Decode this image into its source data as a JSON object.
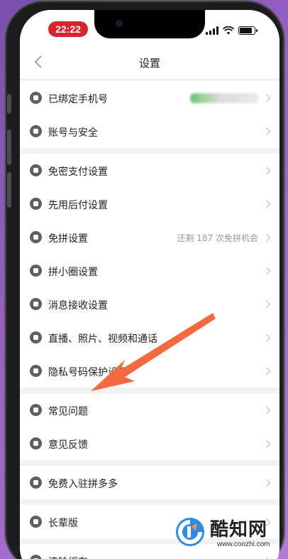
{
  "status_bar": {
    "time": "22:22",
    "time_pill_color": "#d9232d",
    "signal_bars": 4,
    "battery_level": 0.85,
    "icons": [
      "signal-icon",
      "wifi-icon",
      "battery-icon"
    ]
  },
  "nav": {
    "title": "设置",
    "back_icon": "chevron-left-icon"
  },
  "groups": [
    {
      "items": [
        {
          "label": "已绑定手机号",
          "icon": "phone-icon",
          "value": "",
          "value_obscured": true
        },
        {
          "label": "账号与安全",
          "icon": "shield-icon",
          "value": ""
        }
      ]
    },
    {
      "items": [
        {
          "label": "免密支付设置",
          "icon": "key-icon",
          "value": ""
        },
        {
          "label": "先用后付设置",
          "icon": "clock-icon",
          "value": ""
        },
        {
          "label": "免拼设置",
          "icon": "group-icon",
          "value": "还剩 187 次免拼机会"
        },
        {
          "label": "拼小圈设置",
          "icon": "circle-icon",
          "value": ""
        },
        {
          "label": "消息接收设置",
          "icon": "message-icon",
          "value": ""
        },
        {
          "label": "直播、照片、视频和通话",
          "icon": "video-icon",
          "value": ""
        },
        {
          "label": "隐私号码保护设置",
          "icon": "privacy-icon",
          "value": ""
        }
      ]
    },
    {
      "items": [
        {
          "label": "常见问题",
          "icon": "question-icon",
          "value": ""
        },
        {
          "label": "意见反馈",
          "icon": "edit-icon",
          "value": ""
        }
      ]
    },
    {
      "items": [
        {
          "label": "免费入驻拼多多",
          "icon": "store-icon",
          "value": ""
        }
      ]
    },
    {
      "items": [
        {
          "label": "长辈版",
          "icon": "elder-icon",
          "value": ""
        }
      ]
    },
    {
      "items": [
        {
          "label": "清除缓存",
          "icon": "trash-icon",
          "value": ""
        }
      ]
    }
  ],
  "annotation": {
    "arrow_color": "#f26a3d",
    "points_to": "常见问题"
  },
  "watermark": {
    "title": "酷知网",
    "url": "www.coozhi.com",
    "logo_colors": [
      "#2b8be6",
      "#f29a2e"
    ]
  }
}
